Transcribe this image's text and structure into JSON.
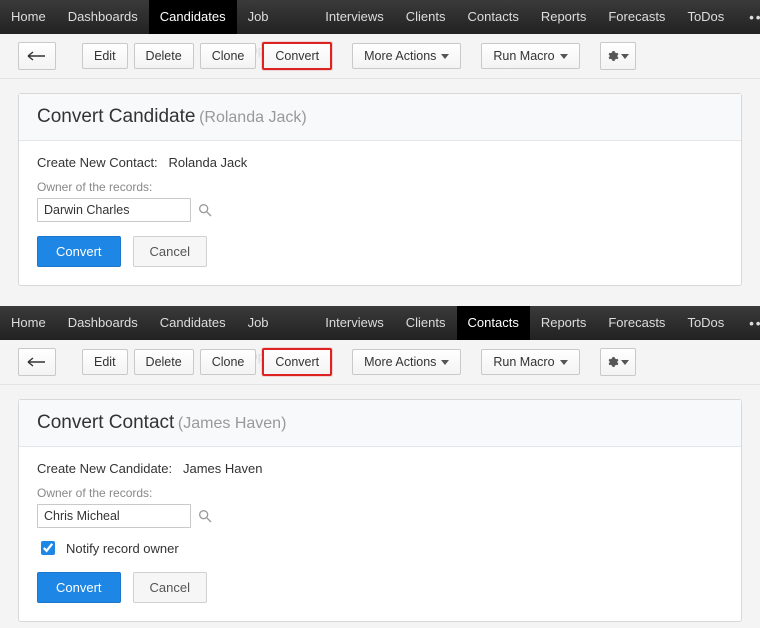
{
  "nav_items": [
    "Home",
    "Dashboards",
    "Candidates",
    "Job Openings",
    "Interviews",
    "Clients",
    "Contacts",
    "Reports",
    "Forecasts",
    "ToDos"
  ],
  "top": {
    "active_nav": "Candidates",
    "toolbar": {
      "edit": "Edit",
      "delete": "Delete",
      "clone": "Clone",
      "convert": "Convert",
      "more": "More Actions",
      "macro": "Run Macro"
    },
    "panel": {
      "title": "Convert Candidate",
      "entity": "(Rolanda Jack)",
      "create_label": "Create New Contact:",
      "create_value": "Rolanda Jack",
      "owner_label": "Owner of the records:",
      "owner_value": "Darwin Charles",
      "convert": "Convert",
      "cancel": "Cancel"
    }
  },
  "bottom": {
    "active_nav": "Contacts",
    "toolbar": {
      "edit": "Edit",
      "delete": "Delete",
      "clone": "Clone",
      "convert": "Convert",
      "more": "More Actions",
      "macro": "Run Macro"
    },
    "panel": {
      "title": "Convert Contact",
      "entity": "(James Haven)",
      "create_label": "Create New Candidate:",
      "create_value": "James Haven",
      "owner_label": "Owner of the records:",
      "owner_value": "Chris Micheal",
      "notify": "Notify record owner",
      "convert": "Convert",
      "cancel": "Cancel"
    }
  }
}
